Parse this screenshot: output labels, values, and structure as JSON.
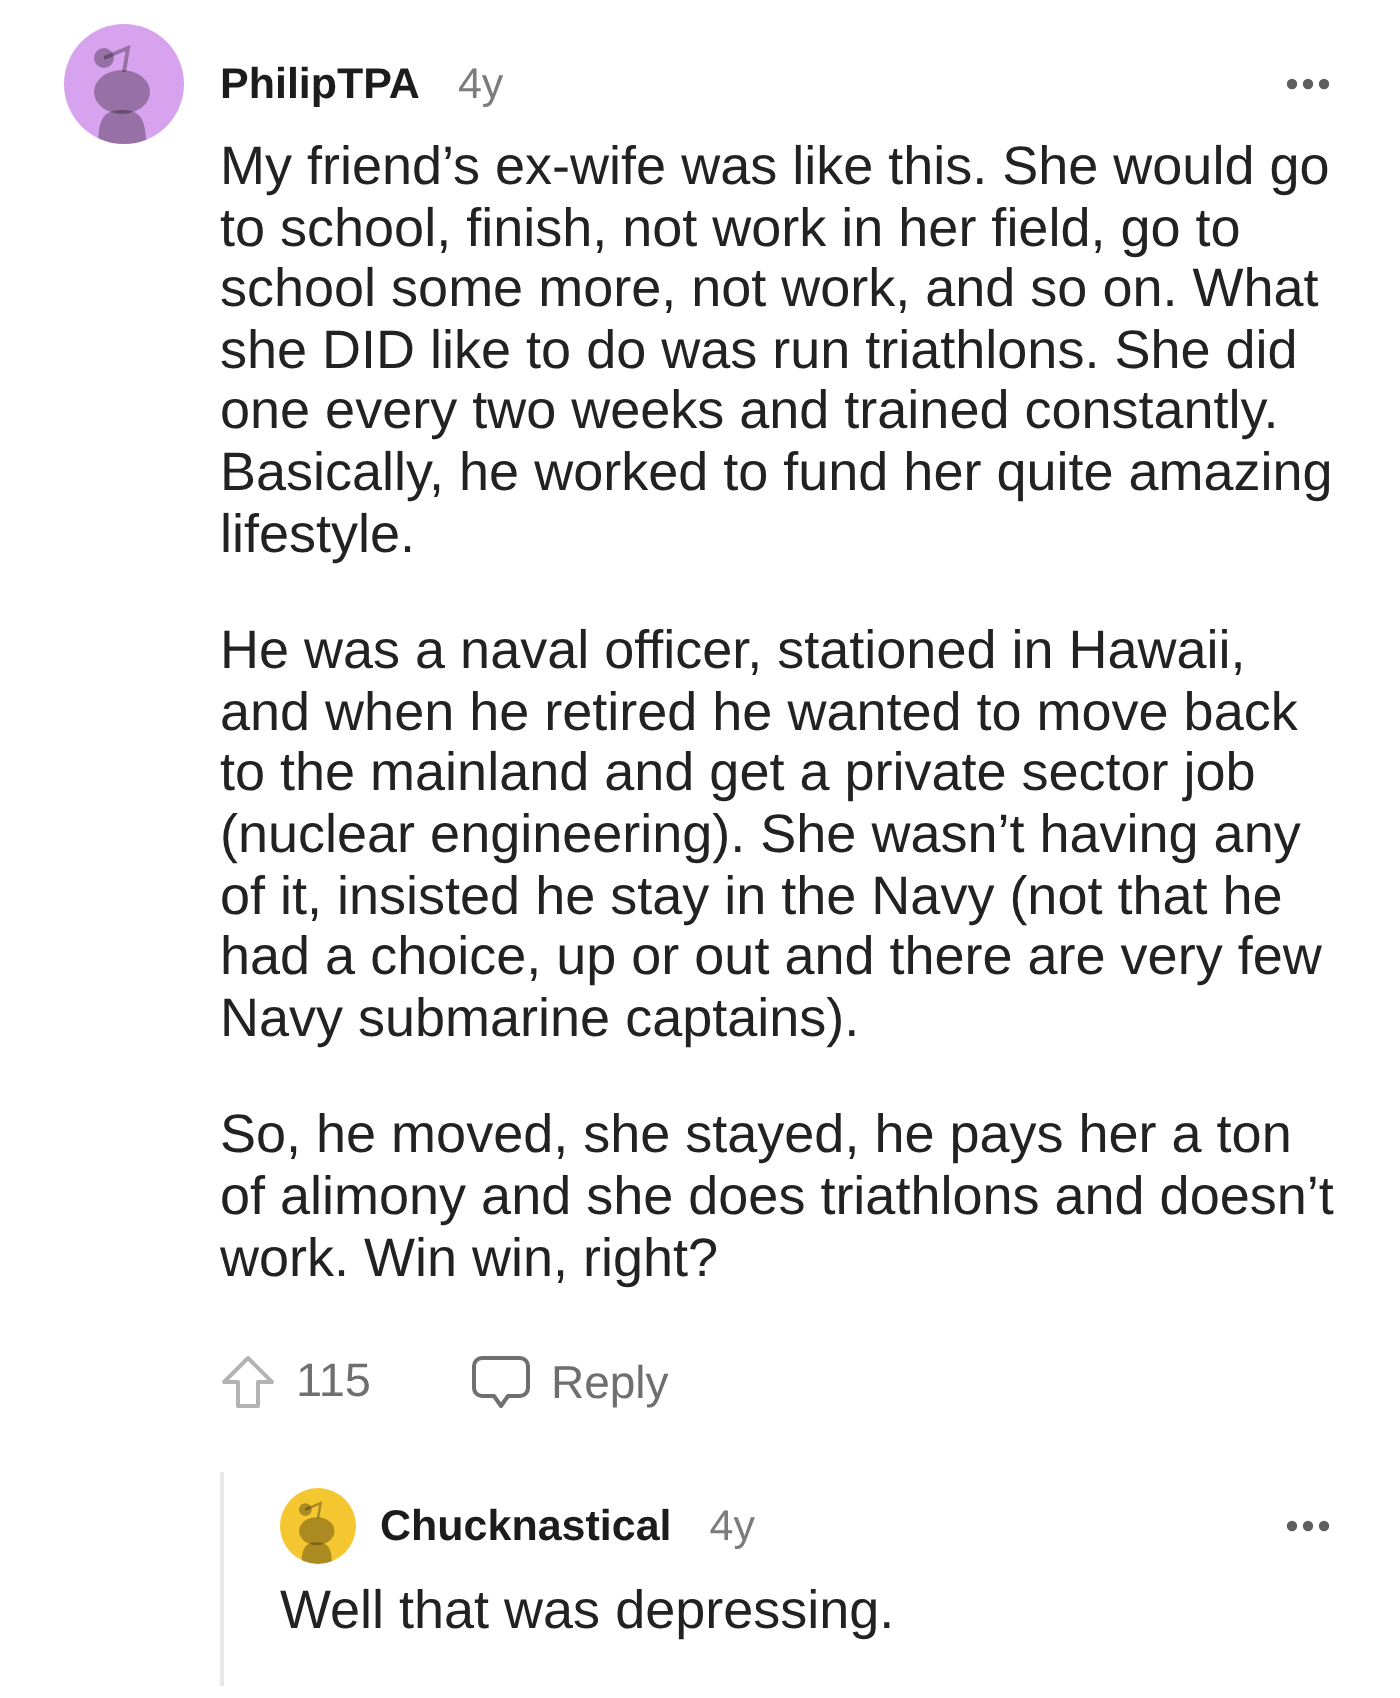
{
  "comments": [
    {
      "author": "PhilipTPA",
      "age": "4y",
      "color": "#d8a3ee",
      "paragraphs": [
        "My friend’s ex-wife was like this. She would go to school, finish, not work in her field, go to school some more, not work, and so on. What she DID like to do was run triathlons. She did one every two weeks and trained constantly. Basically, he worked to fund her quite amazing lifestyle.",
        "He was a naval officer, stationed in Hawaii, and when he retired he wanted to move back to the mainland and get a private sector job (nuclear engineering). She wasn’t having any of it, insisted he stay in the Navy (not that he had a choice, up or out and there are very few Navy submarine captains).",
        "So, he moved, she stayed, he pays her a ton of alimony and she does triathlons and doesn’t work. Win win, right?"
      ],
      "votes": "115",
      "reply_label": "Reply",
      "children": [
        {
          "author": "Chucknastical",
          "age": "4y",
          "color": "#f4c630",
          "paragraphs": [
            "Well that was depressing."
          ]
        }
      ]
    }
  ]
}
